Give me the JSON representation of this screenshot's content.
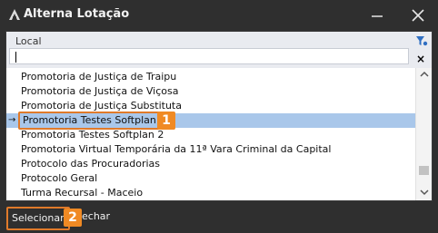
{
  "window": {
    "title": "Alterna Lotação",
    "minimize_icon": "minus-icon",
    "close_icon": "close-icon"
  },
  "grid": {
    "column_header": "Local",
    "filter_value": "",
    "filter_icon": "funnel-icon",
    "clear_filter_label": "×",
    "rows": [
      {
        "label": "Promotoria de Justiça de Traipu",
        "selected": false
      },
      {
        "label": "Promotoria de Justiça de Viçosa",
        "selected": false
      },
      {
        "label": "Promotoria de Justiça Substituta",
        "selected": false
      },
      {
        "label": "Promotoria Testes Softplan",
        "selected": true
      },
      {
        "label": "Promotoria Testes Softplan 2",
        "selected": false
      },
      {
        "label": "Promotoria Virtual Temporária da 11ª Vara Criminal da Capital",
        "selected": false
      },
      {
        "label": "Protocolo das Procuradorias",
        "selected": false
      },
      {
        "label": "Protocolo Geral",
        "selected": false
      },
      {
        "label": "Turma Recursal - Maceio",
        "selected": false
      }
    ],
    "current_row_indicator": "→",
    "scrollbar": {
      "position": 0.9
    }
  },
  "annotations": {
    "badge_1": "1",
    "badge_2": "2"
  },
  "footer": {
    "select_label": "Selecionar",
    "close_label": "echar"
  },
  "colors": {
    "titlebar_bg": "#2f2f2f",
    "selection_bg": "#a9c7ea",
    "highlight_outline": "#e07a2a",
    "badge_bg": "#f08a24"
  }
}
